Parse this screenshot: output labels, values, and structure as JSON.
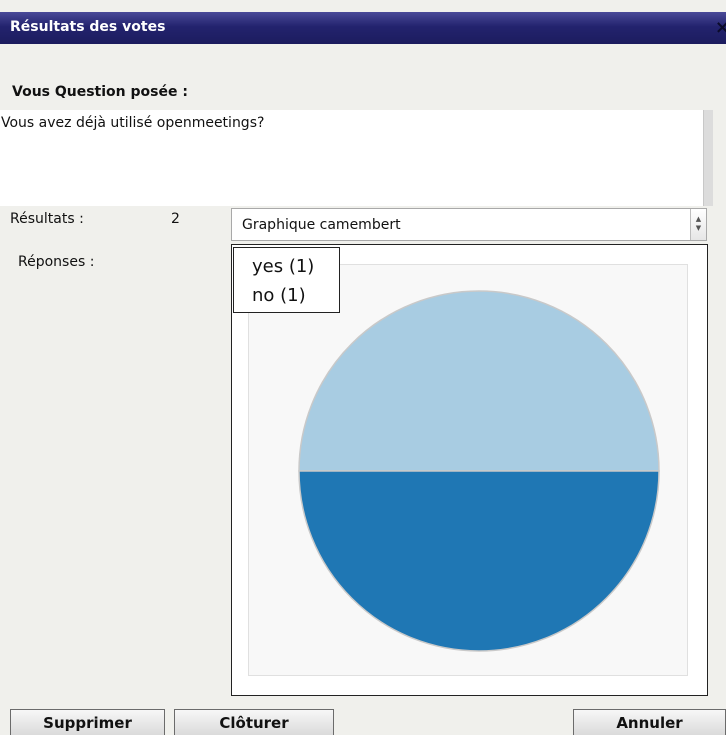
{
  "window": {
    "title": "Résultats des votes",
    "close_glyph": "×"
  },
  "question": {
    "label": "Vous Question posée :",
    "text": "Vous avez déjà utilisé openmeetings?"
  },
  "results": {
    "label": "Résultats :",
    "count": "2",
    "responses_label": "Réponses :"
  },
  "chart_type_select": {
    "selected": "Graphique camembert"
  },
  "legend": {
    "items": [
      "yes (1)",
      "no (1)"
    ]
  },
  "chart_data": {
    "type": "pie",
    "categories": [
      "yes",
      "no"
    ],
    "values": [
      1,
      1
    ],
    "colors": [
      "#a8cce2",
      "#1f77b4"
    ],
    "legend_position": "top-left"
  },
  "buttons": {
    "delete": "Supprimer",
    "close": "Clôturer",
    "cancel": "Annuler"
  }
}
